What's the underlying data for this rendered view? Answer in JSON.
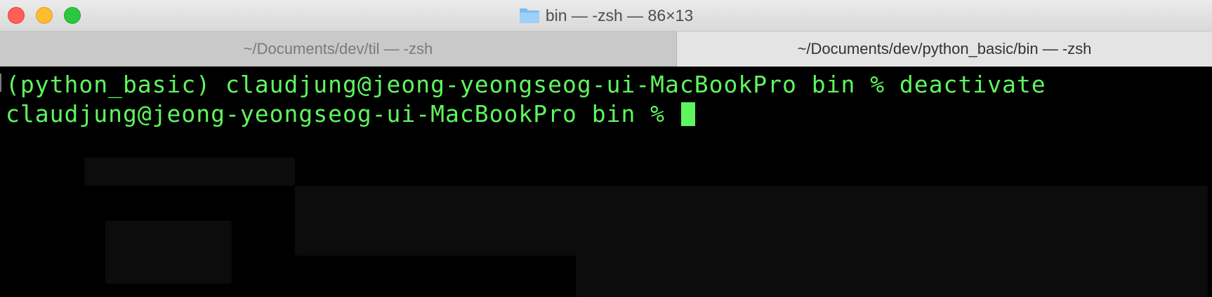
{
  "window": {
    "title": "bin — -zsh — 86×13",
    "folder_icon": "folder-icon"
  },
  "tabs": [
    {
      "label": "~/Documents/dev/til — -zsh",
      "active": false
    },
    {
      "label": "~/Documents/dev/python_basic/bin — -zsh",
      "active": true
    }
  ],
  "terminal": {
    "line1": "(python_basic) claudjung@jeong-yeongseog-ui-MacBookPro bin % deactivate",
    "line2": "claudjung@jeong-yeongseog-ui-MacBookPro bin % ",
    "text_color": "#5ff55f",
    "background": "#000000"
  },
  "colors": {
    "close": "#fe5f57",
    "minimize": "#febc2e",
    "maximize": "#29c840"
  }
}
